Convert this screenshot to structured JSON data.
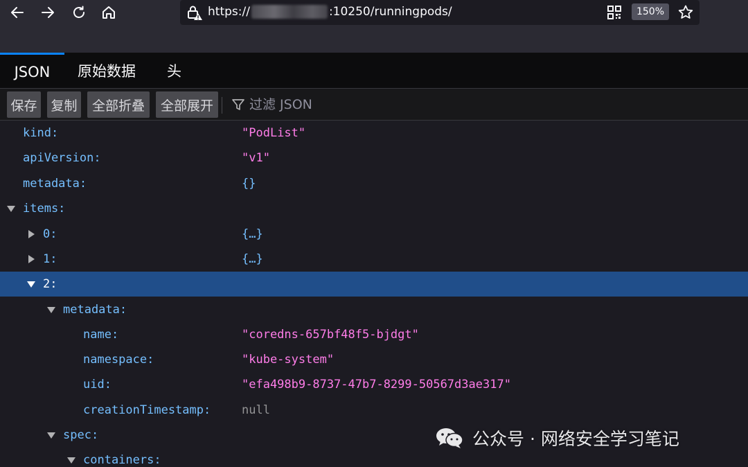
{
  "browser": {
    "url_prefix": "https://",
    "url_suffix": ":10250/runningpods/",
    "zoom": "150%"
  },
  "tabs": [
    {
      "label": "JSON",
      "active": true
    },
    {
      "label": "原始数据",
      "active": false
    },
    {
      "label": "头",
      "active": false
    }
  ],
  "toolbar": {
    "save_label": "保存",
    "copy_label": "复制",
    "collapse_label": "全部折叠",
    "expand_label": "全部展开",
    "filter_placeholder": "过滤 JSON"
  },
  "tree": {
    "kind": {
      "key": "kind:",
      "value": "\"PodList\""
    },
    "apiVersion": {
      "key": "apiVersion:",
      "value": "\"v1\""
    },
    "metadata": {
      "key": "metadata:",
      "value": "{}"
    },
    "items": {
      "key": "items:"
    },
    "item0": {
      "key": "0:",
      "value": "{…}"
    },
    "item1": {
      "key": "1:",
      "value": "{…}"
    },
    "item2": {
      "key": "2:"
    },
    "item2_metadata": {
      "key": "metadata:"
    },
    "name": {
      "key": "name:",
      "value": "\"coredns-657bf48f5-bjdgt\""
    },
    "namespace": {
      "key": "namespace:",
      "value": "\"kube-system\""
    },
    "uid": {
      "key": "uid:",
      "value": "\"efa498b9-8737-47b7-8299-50567d3ae317\""
    },
    "creationTimestamp": {
      "key": "creationTimestamp:",
      "value": "null"
    },
    "spec": {
      "key": "spec:"
    },
    "containers": {
      "key": "containers:"
    }
  },
  "watermark": {
    "text": "公众号 · 网络安全学习笔记"
  },
  "colors": {
    "accent": "#0a84ff",
    "selected_row": "#204e8a",
    "key": "#75bfff",
    "string": "#ff7de9",
    "null": "#939395"
  }
}
